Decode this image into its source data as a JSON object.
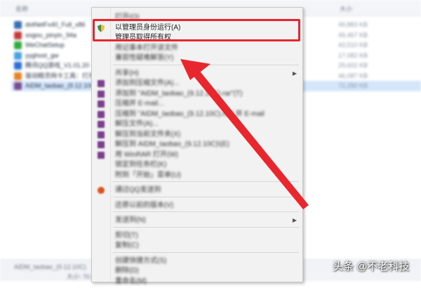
{
  "explorer": {
    "header": {
      "name_col": "名称",
      "size_col": "大小"
    },
    "files": [
      {
        "name": "dotNetFx40_Full_x86",
        "size": "49,883 KB",
        "color": "#3a6fb5"
      },
      {
        "name": "sogou_pinyin_94a",
        "size": "49,467 KB",
        "color": "#c23b3b"
      },
      {
        "name": "WeChatSetup",
        "size": "43,510 KB",
        "color": "#2eab3f"
      },
      {
        "name": "yyghost_gw",
        "size": "17,082 KB",
        "color": "#4aa3df"
      },
      {
        "name": "腾讯QQ游戏_V1.01.20",
        "size": "29,602 KB",
        "color": "#2d6fd6"
      },
      {
        "name": "驱动精灵网卡工具：打开",
        "size": "46,087 KB",
        "color": "#e1842a"
      },
      {
        "name": "AIDM_taobao_(9.12.10C)",
        "size": "72,280 KB",
        "color": "#7a4b8f",
        "selected": true
      }
    ],
    "status": {
      "left": "AIDM_taobao_(9.12.10C)",
      "date": "2019",
      "size": "大小: 70.5"
    }
  },
  "context_menu": {
    "items": [
      {
        "label": "打开(O)",
        "blurred": true,
        "icon": "none",
        "type": "item"
      },
      {
        "label": "以管理员身份运行(A)",
        "blurred": false,
        "icon": "shield-icon",
        "type": "item"
      },
      {
        "label": "管理员取得所有权",
        "blurred": false,
        "icon": "none",
        "type": "item"
      },
      {
        "label": "用记事本打开该文件",
        "blurred": true,
        "icon": "none",
        "type": "item"
      },
      {
        "label": "兼容性疑难解答(Y)",
        "blurred": true,
        "icon": "none",
        "type": "item"
      },
      {
        "type": "separator"
      },
      {
        "label": "共享(H)",
        "blurred": true,
        "icon": "none",
        "type": "item",
        "submenu": true
      },
      {
        "label": "添加到压缩文件(A)...",
        "blurred": true,
        "icon": "winrar-icon",
        "type": "item"
      },
      {
        "label": "添加到 \"AIDM_taobao_(9.12.10C).rar\"(T)",
        "blurred": true,
        "icon": "winrar-icon",
        "type": "item"
      },
      {
        "label": "压缩并 E-mail...",
        "blurred": true,
        "icon": "winrar-icon",
        "type": "item"
      },
      {
        "label": "压缩到 \"AIDM_taobao_(9.12.10C).rar\" 并 E-mail",
        "blurred": true,
        "icon": "winrar-icon",
        "type": "item"
      },
      {
        "label": "解压文件(A)...",
        "blurred": true,
        "icon": "winrar-icon",
        "type": "item"
      },
      {
        "label": "解压到当前文件夹(X)",
        "blurred": true,
        "icon": "winrar-icon",
        "type": "item"
      },
      {
        "label": "解压到 AIDM_taobao_(9.12.10C)\\(E)",
        "blurred": true,
        "icon": "winrar-icon",
        "type": "item"
      },
      {
        "label": "用 WinRAR 打开(W)",
        "blurred": true,
        "icon": "winrar-icon",
        "type": "item"
      },
      {
        "label": "锁定到任务栏(K)",
        "blurred": true,
        "icon": "none",
        "type": "item"
      },
      {
        "label": "附到「开始」菜单(U)",
        "blurred": true,
        "icon": "none",
        "type": "item"
      },
      {
        "type": "separator"
      },
      {
        "label": "通过QQ发送到",
        "blurred": true,
        "icon": "qq-icon",
        "type": "item",
        "submenu": true
      },
      {
        "type": "separator"
      },
      {
        "label": "还原以前的版本(V)",
        "blurred": true,
        "icon": "none",
        "type": "item"
      },
      {
        "type": "separator"
      },
      {
        "label": "发送到(N)",
        "blurred": true,
        "icon": "none",
        "type": "item",
        "submenu": true
      },
      {
        "type": "separator"
      },
      {
        "label": "剪切(T)",
        "blurred": true,
        "icon": "none",
        "type": "item"
      },
      {
        "label": "复制(C)",
        "blurred": true,
        "icon": "none",
        "type": "item"
      },
      {
        "type": "separator"
      },
      {
        "label": "创建快捷方式(S)",
        "blurred": true,
        "icon": "none",
        "type": "item"
      },
      {
        "label": "删除(D)",
        "blurred": true,
        "icon": "none",
        "type": "item"
      },
      {
        "label": "重命名(M)",
        "blurred": true,
        "icon": "none",
        "type": "item"
      }
    ]
  },
  "annotation": {
    "color": "#e8262d",
    "arrow_icon": "red-arrow-icon"
  },
  "watermark": {
    "text": "头条 @不老科技"
  }
}
